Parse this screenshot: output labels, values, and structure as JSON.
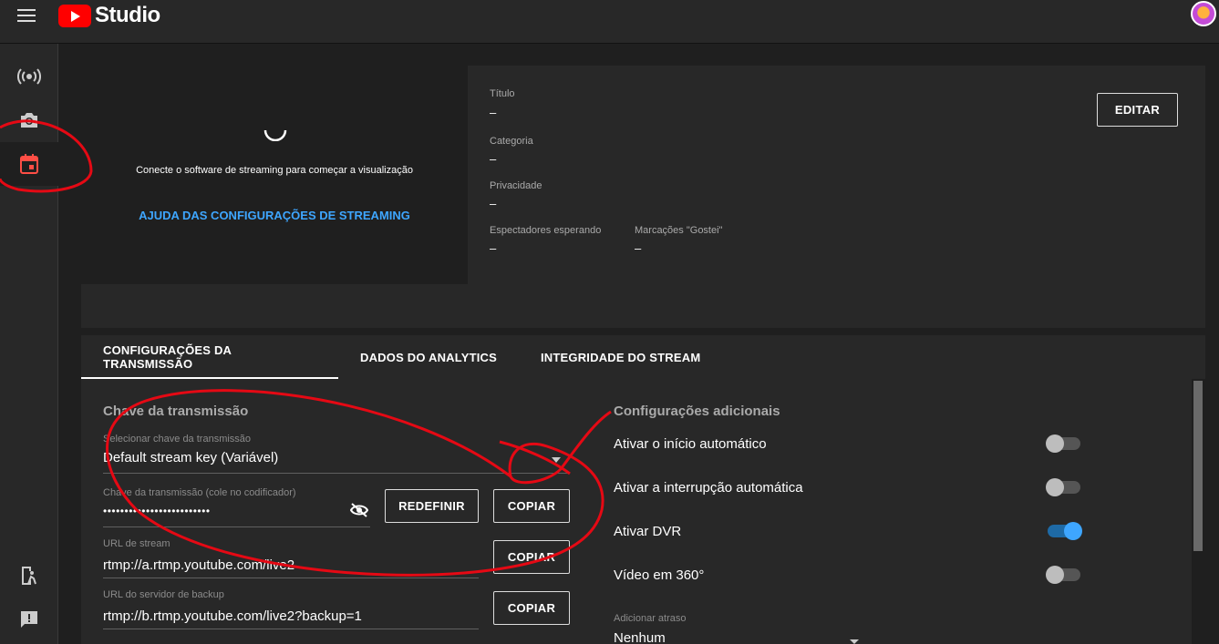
{
  "app": {
    "title": "Studio"
  },
  "preview": {
    "connect_text": "Conecte o software de streaming para começar a visualização",
    "help_link": "AJUDA DAS CONFIGURAÇÕES DE STREAMING"
  },
  "info": {
    "title_label": "Título",
    "title_value": "–",
    "category_label": "Categoria",
    "category_value": "–",
    "privacy_label": "Privacidade",
    "privacy_value": "–",
    "waiting_label": "Espectadores esperando",
    "waiting_value": "–",
    "likes_label": "Marcações \"Gostei\"",
    "likes_value": "–",
    "edit_button": "EDITAR"
  },
  "tabs": [
    {
      "label": "CONFIGURAÇÕES DA TRANSMISSÃO",
      "active": true
    },
    {
      "label": "DADOS DO ANALYTICS",
      "active": false
    },
    {
      "label": "INTEGRIDADE DO STREAM",
      "active": false
    }
  ],
  "stream_key": {
    "section_title": "Chave da transmissão",
    "select_label": "Selecionar chave da transmissão",
    "select_value": "Default stream key (Variável)",
    "key_label": "Chave da transmissão (cole no codificador)",
    "key_value": "•••••••••••••••••••••••••",
    "reset_button": "REDEFINIR",
    "copy_button": "COPIAR",
    "url_label": "URL de stream",
    "url_value": "rtmp://a.rtmp.youtube.com/live2",
    "backup_label": "URL do servidor de backup",
    "backup_value": "rtmp://b.rtmp.youtube.com/live2?backup=1"
  },
  "additional": {
    "section_title": "Configurações adicionais",
    "settings": [
      {
        "label": "Ativar o início automático",
        "on": false
      },
      {
        "label": "Ativar a interrupção automática",
        "on": false
      },
      {
        "label": "Ativar DVR",
        "on": true
      },
      {
        "label": "Vídeo em 360°",
        "on": false
      }
    ],
    "delay_label": "Adicionar atraso",
    "delay_value": "Nenhum"
  },
  "colors": {
    "accent": "#3ea6ff",
    "brand": "#ff0000",
    "annotation": "#e50914"
  }
}
